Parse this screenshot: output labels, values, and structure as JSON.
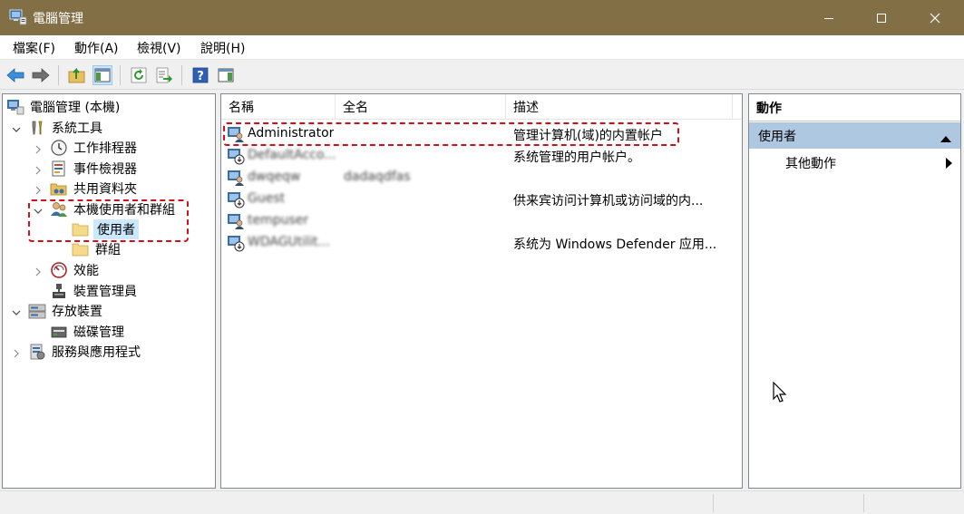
{
  "window": {
    "title": "電腦管理",
    "controls": [
      "minimize",
      "maximize",
      "close"
    ]
  },
  "menu": [
    {
      "label": "檔案(F)"
    },
    {
      "label": "動作(A)"
    },
    {
      "label": "檢視(V)"
    },
    {
      "label": "說明(H)"
    }
  ],
  "toolbar": {
    "buttons": [
      "back-arrow-icon",
      "forward-arrow-icon",
      "up-folder-icon",
      "show-hide-tree-icon",
      "refresh-icon",
      "export-list-icon",
      "help-icon",
      "show-hide-action-pane-icon"
    ]
  },
  "tree": {
    "root": "電腦管理 (本機)",
    "system_tools": "系統工具",
    "task_scheduler": "工作排程器",
    "event_viewer": "事件檢視器",
    "shared_folders": "共用資料夾",
    "local_users_groups": "本機使用者和群組",
    "users": "使用者",
    "groups": "群組",
    "performance": "效能",
    "device_manager": "裝置管理員",
    "storage": "存放裝置",
    "disk_management": "磁碟管理",
    "services_apps": "服務與應用程式"
  },
  "list": {
    "columns": {
      "name": "名稱",
      "fullname": "全名",
      "description": "描述"
    },
    "rows": [
      {
        "name": "Administrator",
        "fullname": "",
        "description": "管理计算机(域)的内置帐户"
      },
      {
        "name": "DefaultAcco...",
        "fullname": "",
        "description": "系统管理的用户帐户。"
      },
      {
        "name": "dwqeqw",
        "fullname": "dadaqdfas",
        "description": ""
      },
      {
        "name": "Guest",
        "fullname": "",
        "description": "供来宾访问计算机或访问域的内..."
      },
      {
        "name": "tempuser",
        "fullname": "",
        "description": ""
      },
      {
        "name": "WDAGUtilit...",
        "fullname": "",
        "description": "系统为 Windows Defender 应用..."
      }
    ]
  },
  "actions": {
    "header": "動作",
    "section": "使用者",
    "more": "其他動作"
  },
  "colors": {
    "titlebar": "#826f45",
    "annotation": "#d0101a",
    "selection": "#cce8ff",
    "action_section": "#aec8e2"
  }
}
